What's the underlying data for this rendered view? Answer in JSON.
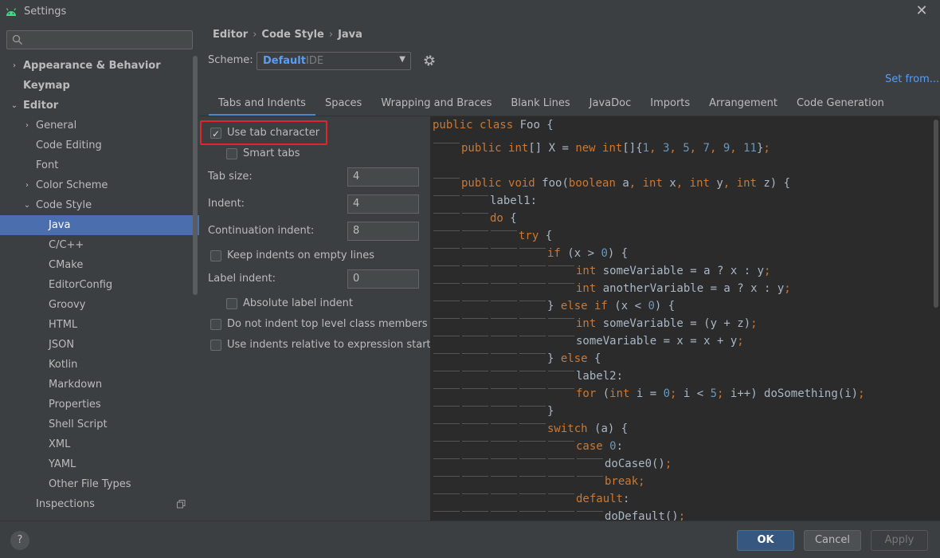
{
  "window": {
    "title": "Settings"
  },
  "search": {
    "placeholder": ""
  },
  "sidebar": {
    "items": [
      {
        "label": "Appearance & Behavior",
        "level": 0,
        "arrow": "›",
        "bold": true
      },
      {
        "label": "Keymap",
        "level": 0,
        "arrow": "",
        "bold": true
      },
      {
        "label": "Editor",
        "level": 0,
        "arrow": "⌄",
        "bold": true
      },
      {
        "label": "General",
        "level": 1,
        "arrow": "›"
      },
      {
        "label": "Code Editing",
        "level": 1,
        "arrow": ""
      },
      {
        "label": "Font",
        "level": 1,
        "arrow": ""
      },
      {
        "label": "Color Scheme",
        "level": 1,
        "arrow": "›"
      },
      {
        "label": "Code Style",
        "level": 1,
        "arrow": "⌄"
      },
      {
        "label": "Java",
        "level": 2,
        "arrow": "",
        "selected": true
      },
      {
        "label": "C/C++",
        "level": 2,
        "arrow": ""
      },
      {
        "label": "CMake",
        "level": 2,
        "arrow": ""
      },
      {
        "label": "EditorConfig",
        "level": 2,
        "arrow": ""
      },
      {
        "label": "Groovy",
        "level": 2,
        "arrow": ""
      },
      {
        "label": "HTML",
        "level": 2,
        "arrow": ""
      },
      {
        "label": "JSON",
        "level": 2,
        "arrow": ""
      },
      {
        "label": "Kotlin",
        "level": 2,
        "arrow": ""
      },
      {
        "label": "Markdown",
        "level": 2,
        "arrow": ""
      },
      {
        "label": "Properties",
        "level": 2,
        "arrow": ""
      },
      {
        "label": "Shell Script",
        "level": 2,
        "arrow": ""
      },
      {
        "label": "XML",
        "level": 2,
        "arrow": ""
      },
      {
        "label": "YAML",
        "level": 2,
        "arrow": ""
      },
      {
        "label": "Other File Types",
        "level": 2,
        "arrow": ""
      },
      {
        "label": "Inspections",
        "level": 1,
        "arrow": "",
        "copy": true
      }
    ]
  },
  "breadcrumb": {
    "items": [
      "Editor",
      "Code Style",
      "Java"
    ],
    "separator": "›"
  },
  "scheme": {
    "label": "Scheme:",
    "value": "Default",
    "sub": "IDE"
  },
  "set_from": "Set from...",
  "tabs": [
    "Tabs and Indents",
    "Spaces",
    "Wrapping and Braces",
    "Blank Lines",
    "JavaDoc",
    "Imports",
    "Arrangement",
    "Code Generation"
  ],
  "active_tab": "Tabs and Indents",
  "options": {
    "use_tab_character": {
      "label": "Use tab character",
      "checked": true
    },
    "smart_tabs": {
      "label": "Smart tabs",
      "checked": false
    },
    "tab_size": {
      "label": "Tab size:",
      "value": "4"
    },
    "indent": {
      "label": "Indent:",
      "value": "4"
    },
    "continuation_indent": {
      "label": "Continuation indent:",
      "value": "8"
    },
    "keep_indents": {
      "label": "Keep indents on empty lines",
      "checked": false
    },
    "label_indent": {
      "label": "Label indent:",
      "value": "0"
    },
    "absolute_label_indent": {
      "label": "Absolute label indent",
      "checked": false
    },
    "no_indent_top": {
      "label": "Do not indent top level class members",
      "checked": false
    },
    "relative_indents": {
      "label": "Use indents relative to expression start",
      "checked": false
    }
  },
  "code_lines": [
    {
      "indent": 0,
      "tokens": [
        [
          "kw",
          "public "
        ],
        [
          "kw",
          "class "
        ],
        [
          "plain",
          "Foo {"
        ]
      ]
    },
    {
      "indent": 1,
      "tokens": [
        [
          "kw",
          "public "
        ],
        [
          "kw",
          "int"
        ],
        [
          "plain",
          "[] X = "
        ],
        [
          "kw",
          "new "
        ],
        [
          "kw",
          "int"
        ],
        [
          "plain",
          "[]{"
        ],
        [
          "num",
          "1"
        ],
        [
          "kw",
          ", "
        ],
        [
          "num",
          "3"
        ],
        [
          "kw",
          ", "
        ],
        [
          "num",
          "5"
        ],
        [
          "kw",
          ", "
        ],
        [
          "num",
          "7"
        ],
        [
          "kw",
          ", "
        ],
        [
          "num",
          "9"
        ],
        [
          "kw",
          ", "
        ],
        [
          "num",
          "11"
        ],
        [
          "plain",
          "}"
        ],
        [
          "kw",
          ";"
        ]
      ]
    },
    {
      "indent": 0,
      "tokens": []
    },
    {
      "indent": 1,
      "tokens": [
        [
          "kw",
          "public "
        ],
        [
          "kw",
          "void "
        ],
        [
          "plain",
          "foo("
        ],
        [
          "kw",
          "boolean "
        ],
        [
          "plain",
          "a"
        ],
        [
          "kw",
          ", "
        ],
        [
          "kw",
          "int "
        ],
        [
          "plain",
          "x"
        ],
        [
          "kw",
          ", "
        ],
        [
          "kw",
          "int "
        ],
        [
          "plain",
          "y"
        ],
        [
          "kw",
          ", "
        ],
        [
          "kw",
          "int "
        ],
        [
          "plain",
          "z) {"
        ]
      ]
    },
    {
      "indent": 2,
      "tokens": [
        [
          "plain",
          "label1:"
        ]
      ]
    },
    {
      "indent": 2,
      "tokens": [
        [
          "kw",
          "do "
        ],
        [
          "plain",
          "{"
        ]
      ]
    },
    {
      "indent": 3,
      "tokens": [
        [
          "kw",
          "try "
        ],
        [
          "plain",
          "{"
        ]
      ]
    },
    {
      "indent": 4,
      "tokens": [
        [
          "kw",
          "if "
        ],
        [
          "plain",
          "(x > "
        ],
        [
          "num",
          "0"
        ],
        [
          "plain",
          ") {"
        ]
      ]
    },
    {
      "indent": 5,
      "tokens": [
        [
          "kw",
          "int "
        ],
        [
          "plain",
          "someVariable = a ? x : y"
        ],
        [
          "kw",
          ";"
        ]
      ]
    },
    {
      "indent": 5,
      "tokens": [
        [
          "kw",
          "int "
        ],
        [
          "plain",
          "anotherVariable = a ? x : y"
        ],
        [
          "kw",
          ";"
        ]
      ]
    },
    {
      "indent": 4,
      "tokens": [
        [
          "plain",
          "} "
        ],
        [
          "kw",
          "else if "
        ],
        [
          "plain",
          "(x < "
        ],
        [
          "num",
          "0"
        ],
        [
          "plain",
          ") {"
        ]
      ]
    },
    {
      "indent": 5,
      "tokens": [
        [
          "kw",
          "int "
        ],
        [
          "plain",
          "someVariable = (y + z)"
        ],
        [
          "kw",
          ";"
        ]
      ]
    },
    {
      "indent": 5,
      "tokens": [
        [
          "plain",
          "someVariable = x = x + y"
        ],
        [
          "kw",
          ";"
        ]
      ]
    },
    {
      "indent": 4,
      "tokens": [
        [
          "plain",
          "} "
        ],
        [
          "kw",
          "else "
        ],
        [
          "plain",
          "{"
        ]
      ]
    },
    {
      "indent": 5,
      "tokens": [
        [
          "plain",
          "label2:"
        ]
      ]
    },
    {
      "indent": 5,
      "tokens": [
        [
          "kw",
          "for "
        ],
        [
          "plain",
          "("
        ],
        [
          "kw",
          "int "
        ],
        [
          "plain",
          "i = "
        ],
        [
          "num",
          "0"
        ],
        [
          "kw",
          "; "
        ],
        [
          "plain",
          "i < "
        ],
        [
          "num",
          "5"
        ],
        [
          "kw",
          "; "
        ],
        [
          "plain",
          "i++) doSomething(i)"
        ],
        [
          "kw",
          ";"
        ]
      ]
    },
    {
      "indent": 4,
      "tokens": [
        [
          "plain",
          "}"
        ]
      ]
    },
    {
      "indent": 4,
      "tokens": [
        [
          "kw",
          "switch "
        ],
        [
          "plain",
          "(a) {"
        ]
      ]
    },
    {
      "indent": 5,
      "tokens": [
        [
          "kw",
          "case "
        ],
        [
          "num",
          "0"
        ],
        [
          "plain",
          ":"
        ]
      ]
    },
    {
      "indent": 6,
      "tokens": [
        [
          "plain",
          "doCase0()"
        ],
        [
          "kw",
          ";"
        ]
      ]
    },
    {
      "indent": 6,
      "tokens": [
        [
          "kw",
          "break;"
        ]
      ]
    },
    {
      "indent": 5,
      "tokens": [
        [
          "kw",
          "default"
        ],
        [
          "plain",
          ":"
        ]
      ]
    },
    {
      "indent": 6,
      "tokens": [
        [
          "plain",
          "doDefault()"
        ],
        [
          "kw",
          ";"
        ]
      ]
    }
  ],
  "buttons": {
    "help": "?",
    "ok": "OK",
    "cancel": "Cancel",
    "apply": "Apply"
  },
  "colors": {
    "accent": "#4b6eaf",
    "link": "#589df6",
    "highlight_border": "#e0262a",
    "keyword": "#cc7832",
    "number": "#6897bb"
  }
}
